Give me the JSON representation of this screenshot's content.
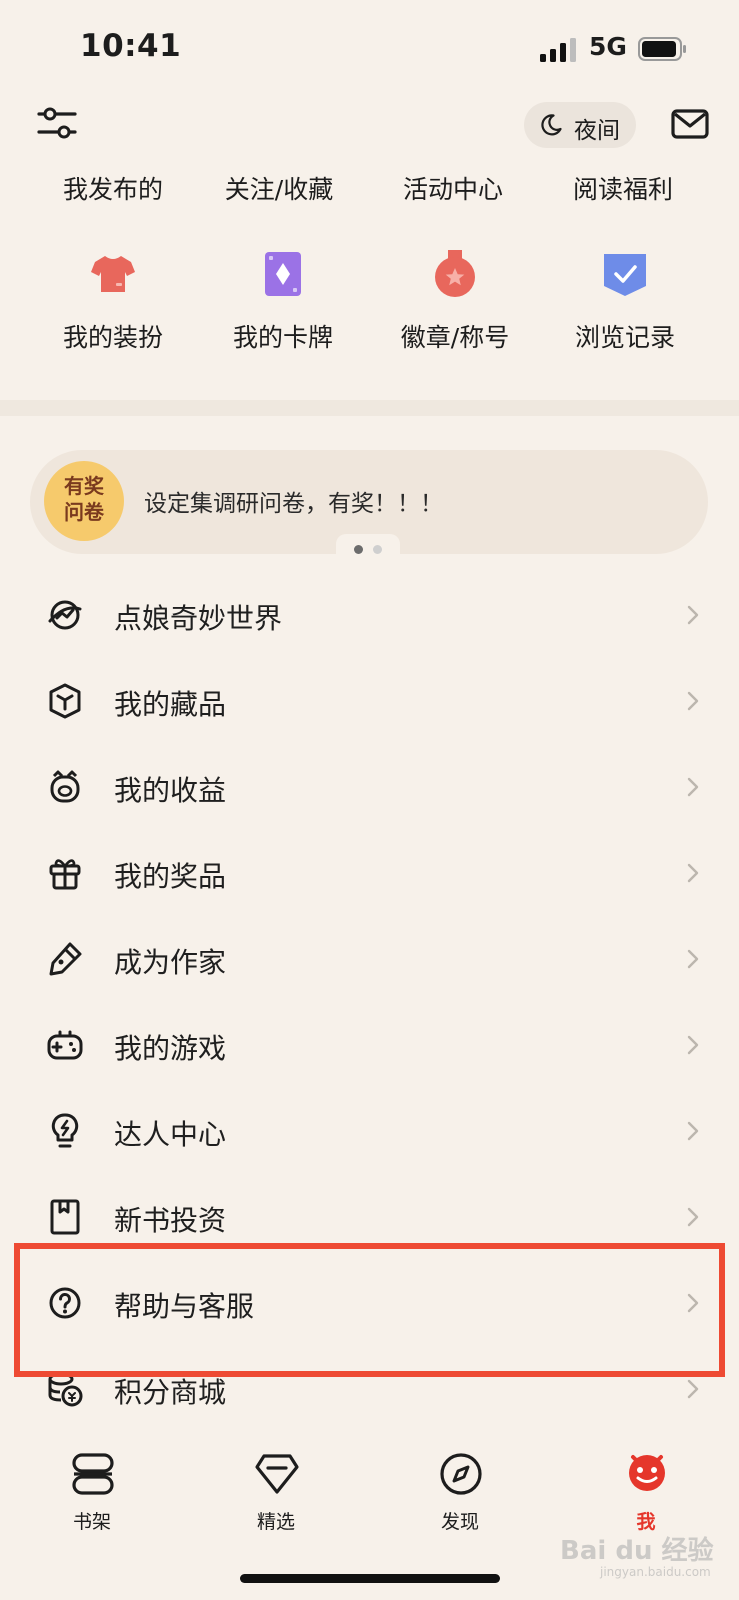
{
  "status_bar": {
    "time": "10:41",
    "network": "5G"
  },
  "header": {
    "night_label": "夜间"
  },
  "quick_links": [
    "我发布的",
    "关注/收藏",
    "活动中心",
    "阅读福利"
  ],
  "icon_grid": [
    {
      "label": "我的装扮",
      "icon": "shirt-icon",
      "color": "#e8675c"
    },
    {
      "label": "我的卡牌",
      "icon": "card-icon",
      "color": "#9b72e6"
    },
    {
      "label": "徽章/称号",
      "icon": "medal-icon",
      "color": "#e8675c"
    },
    {
      "label": "浏览记录",
      "icon": "history-shield-icon",
      "color": "#6e8ce8"
    }
  ],
  "banner": {
    "badge_line1": "有奖",
    "badge_line2": "问卷",
    "text": "设定集调研问卷，有奖！！！"
  },
  "menu": [
    {
      "label": "点娘奇妙世界",
      "icon": "world-icon"
    },
    {
      "label": "我的藏品",
      "icon": "cube-icon"
    },
    {
      "label": "我的收益",
      "icon": "piggy-bank-icon"
    },
    {
      "label": "我的奖品",
      "icon": "gift-icon"
    },
    {
      "label": "成为作家",
      "icon": "pen-icon"
    },
    {
      "label": "我的游戏",
      "icon": "gamepad-icon"
    },
    {
      "label": "达人中心",
      "icon": "lightbulb-icon"
    },
    {
      "label": "新书投资",
      "icon": "book-icon"
    },
    {
      "label": "帮助与客服",
      "icon": "help-icon",
      "highlighted": true
    },
    {
      "label": "积分商城",
      "icon": "coins-icon"
    }
  ],
  "tabbar": [
    {
      "label": "书架",
      "icon": "bookshelf-icon"
    },
    {
      "label": "精选",
      "icon": "diamond-icon"
    },
    {
      "label": "发现",
      "icon": "compass-icon"
    },
    {
      "label": "我",
      "icon": "profile-icon",
      "active": true
    }
  ],
  "colors": {
    "accent": "#e5362b",
    "highlight": "#ee4a33",
    "background": "#f7f1ea"
  },
  "watermark": {
    "brand": "Bai du 经验",
    "url": "jingyan.baidu.com"
  }
}
